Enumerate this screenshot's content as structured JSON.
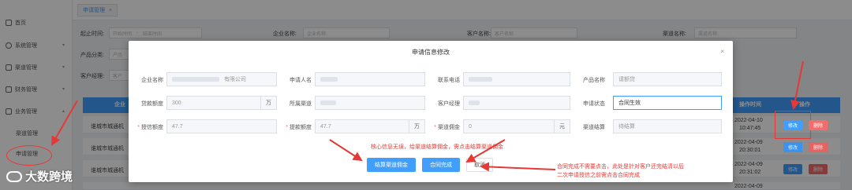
{
  "sidebar": {
    "items": [
      {
        "label": "首页"
      },
      {
        "label": "系统管理"
      },
      {
        "label": "渠道管理"
      },
      {
        "label": "财务管理"
      },
      {
        "label": "业务管理"
      }
    ],
    "subitems": [
      {
        "label": "渠道管理"
      },
      {
        "label": "申请管理"
      }
    ]
  },
  "tabbar": {
    "tab_label": "申请管理",
    "close": "×"
  },
  "filters": {
    "start_time_label": "起止时间:",
    "start_ph": "开始时间",
    "sep": "-",
    "end_ph": "结束时间",
    "company_label": "企业名称:",
    "company_ph": "企业名称",
    "client_label": "客户名称:",
    "client_ph": "客户名称",
    "channel_label": "渠道名称:",
    "channel_ph": "渠道名称",
    "product_label": "产品分类:",
    "product_ph": "产品",
    "manager_label": "客户经理:",
    "manager_ph": "客户"
  },
  "table": {
    "headers": {
      "company": "企业",
      "time": "操作时间",
      "op": "操作"
    },
    "rows": [
      {
        "company": "谁城市城通机",
        "date": "2022-04-10",
        "time": "10:47:45",
        "edit": "修改",
        "del": "删除"
      },
      {
        "company": "谁城市城通机",
        "date": "2022-04-09",
        "time": "20:30:01",
        "edit": "修改",
        "del": "删除"
      },
      {
        "company": "谁城市城通机",
        "date": "2022-04-09",
        "time": "20:31:02",
        "edit": "修改",
        "del": "删除"
      },
      {
        "company": "",
        "date": "2022-04-09",
        "time": "",
        "edit": "",
        "del": ""
      }
    ]
  },
  "modal": {
    "title": "申请信息修改",
    "close": "×",
    "row1": {
      "company_label": "企业名称",
      "company_value": "有限公司",
      "applicant_label": "申请人名",
      "phone_label": "联系电话",
      "product_label": "产品名称",
      "product_value": "请额贷"
    },
    "row2": {
      "loan_label": "贷款额度",
      "loan_value": "300",
      "loan_unit": "万",
      "channel_label": "所属渠道",
      "manager_label": "客户经理",
      "status_label": "申请状态",
      "status_value": "合同生效"
    },
    "row3": {
      "credit_label": "授信额度",
      "credit_value": "47.7",
      "withdraw_label": "提款额度",
      "withdraw_value": "47.7",
      "withdraw_unit": "万",
      "commission_label": "渠道佣金",
      "commission_value": "0",
      "commission_unit": "元",
      "settle_label": "渠道结算",
      "settle_value": "待结算"
    },
    "buttons": {
      "settle": "结算渠道佣金",
      "complete": "合同完成",
      "cancel": "取消"
    }
  },
  "annotations": {
    "note1": "核心信息无误，给渠道结算佣金，需点击结算渠道佣金",
    "note2_line1": "合同完成不需要点击，此处是针对客户还完结清以后",
    "note2_line2": "二次申请授信之前需点击合同完成"
  },
  "watermark": "大数跨境",
  "colors": {
    "primary": "#409eff",
    "danger": "#f56c6c",
    "annotation": "#e53935"
  }
}
